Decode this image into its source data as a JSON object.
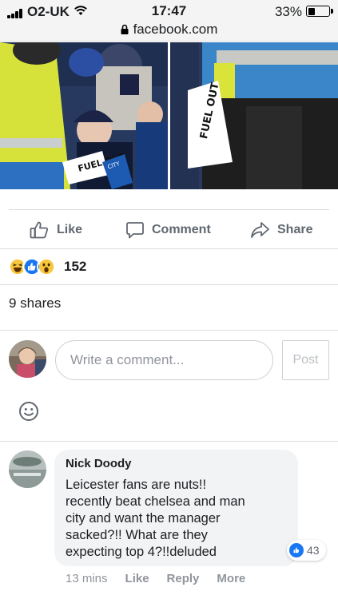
{
  "status_bar": {
    "carrier": "O2-UK",
    "time": "17:47",
    "battery_percent": "33%",
    "battery_level": 0.33,
    "url": "facebook.com"
  },
  "photos": {
    "left_sign_text": "FUEL OUT",
    "right_sign_text": "FUEL OUT",
    "scarf_text": "CITY"
  },
  "actions": {
    "like": "Like",
    "comment": "Comment",
    "share": "Share"
  },
  "reactions": {
    "types": [
      "haha",
      "like",
      "wow"
    ],
    "count": "152"
  },
  "shares": "9 shares",
  "composer": {
    "placeholder": "Write a comment...",
    "post_label": "Post"
  },
  "comment": {
    "author": "Nick Doody",
    "text": "Leicester fans are nuts!!\nrecently beat chelsea and man\ncity and want the manager\nsacked?!! What are they\nexpecting top 4?!!deluded",
    "likes": "43",
    "time": "13 mins",
    "like_label": "Like",
    "reply_label": "Reply",
    "more_label": "More"
  },
  "colors": {
    "facebook_blue": "#1877f2",
    "action_gray": "#606770",
    "meta_gray": "#90949c",
    "bubble_bg": "#f2f3f5"
  }
}
